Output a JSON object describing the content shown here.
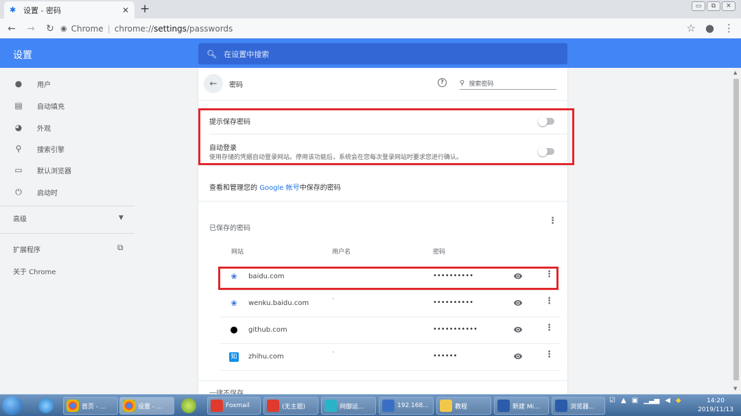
{
  "tab": {
    "title": "设置 - 密码",
    "close": "✕",
    "new_tab": "+"
  },
  "window_controls": [
    "▭",
    "⧉",
    "✕"
  ],
  "address_bar": {
    "site_label": "Chrome",
    "url_prefix": "chrome://",
    "url_bold": "settings",
    "url_suffix": "/passwords"
  },
  "header": {
    "title": "设置",
    "search_placeholder": "在设置中搜索"
  },
  "sidebar": {
    "items": [
      {
        "label": "用户",
        "icon": "person-icon"
      },
      {
        "label": "自动填充",
        "icon": "clipboard-icon"
      },
      {
        "label": "外观",
        "icon": "palette-icon"
      },
      {
        "label": "搜索引擎",
        "icon": "search-icon"
      },
      {
        "label": "默认浏览器",
        "icon": "browser-icon"
      },
      {
        "label": "启动时",
        "icon": "power-icon"
      }
    ],
    "advanced": "高级",
    "extensions": "扩展程序",
    "about": "关于 Chrome"
  },
  "passwords": {
    "title": "密码",
    "search_placeholder": "搜索密码",
    "offer_to_save": "提示保存密码",
    "auto_signin": "自动登录",
    "auto_signin_desc": "使用存储的凭据自动登录网站。停用该功能后，系统会在您每次登录网站时要求您进行确认。",
    "manage_prefix": "查看和管理您的 ",
    "manage_link": "Google 帐号",
    "manage_suffix": "中保存的密码",
    "saved_heading": "已保存的密码",
    "columns": {
      "site": "网站",
      "username": "用户名",
      "password": "密码"
    },
    "rows": [
      {
        "site": "baidu.com",
        "username": "",
        "password": "••••••••••",
        "icon": "baidu-paw-icon"
      },
      {
        "site": "wenku.baidu.com",
        "username": "`",
        "password": "••••••••••",
        "icon": "baidu-paw-icon"
      },
      {
        "site": "github.com",
        "username": "",
        "password": "•••••••••••",
        "icon": "github-icon"
      },
      {
        "site": "zhihu.com",
        "username": "`",
        "password": "••••••",
        "icon": "zhihu-icon"
      }
    ],
    "never_saved": "一律不保存"
  },
  "taskbar": {
    "tasks": [
      {
        "label": "首页 - ..."
      },
      {
        "label": "设置 - ..."
      },
      {
        "label": "Foxmail"
      },
      {
        "label": "(无主题)"
      },
      {
        "label": "网御运..."
      },
      {
        "label": "192.168..."
      },
      {
        "label": "教程"
      },
      {
        "label": "新建 Mi..."
      },
      {
        "label": "浏览器..."
      }
    ],
    "clock_time": "14:20",
    "clock_date": "2019/11/13"
  },
  "colors": {
    "accent": "#4285f4",
    "highlight": "#e0262b"
  }
}
